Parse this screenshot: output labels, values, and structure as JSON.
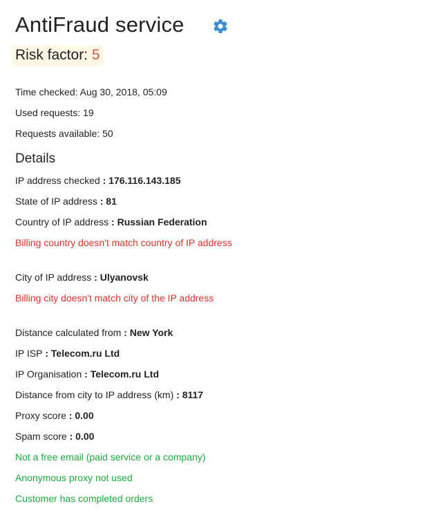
{
  "header": {
    "title": "AntiFraud service",
    "settings_icon": "gear-icon",
    "settings_color": "#3a8fd0"
  },
  "risk": {
    "label": "Risk factor: ",
    "value": "5",
    "highlight_color": "#fcf8e3",
    "value_color": "#d9534f"
  },
  "meta": {
    "time_checked": "Time checked: Aug 30, 2018, 05:09",
    "used_requests": "Used requests: 19",
    "requests_available": "Requests available: 50"
  },
  "details": {
    "heading": "Details",
    "ip_checked": {
      "label": "IP address checked",
      "value": "176.116.143.185"
    },
    "ip_state": {
      "label": "State of IP address",
      "value": "81"
    },
    "ip_country": {
      "label": "Country of IP address",
      "value": "Russian Federation"
    },
    "country_warning": "Billing country doesn't match country of IP address",
    "ip_city": {
      "label": "City of IP address",
      "value": "Ulyanovsk"
    },
    "city_warning": "Billing city doesn't match city of the IP address",
    "distance_from": {
      "label": "Distance calculated from",
      "value": "New York"
    },
    "ip_isp": {
      "label": "IP ISP",
      "value": "Telecom.ru Ltd"
    },
    "ip_org": {
      "label": "IP Organisation",
      "value": "Telecom.ru Ltd"
    },
    "distance_km": {
      "label": "Distance from city to IP address (km)",
      "value": "8117"
    },
    "proxy_score": {
      "label": "Proxy score",
      "value": "0.00"
    },
    "spam_score": {
      "label": "Spam score",
      "value": "0.00"
    },
    "separator": " : ",
    "ok_free_email": "Not a free email (paid service or a company)",
    "ok_proxy": "Anonymous proxy not used",
    "ok_orders": "Customer has completed orders"
  },
  "colors": {
    "warning": "#d9342c",
    "ok": "#1fa83f"
  }
}
